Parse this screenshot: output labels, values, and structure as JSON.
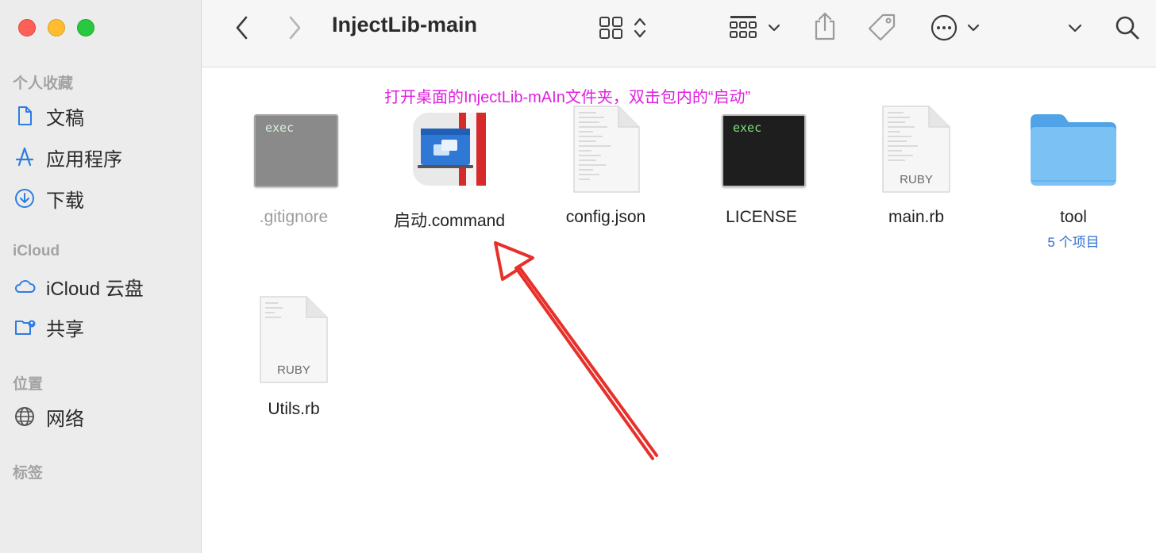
{
  "window": {
    "title": "InjectLib-main"
  },
  "sidebar": {
    "sections": [
      {
        "title": "个人收藏",
        "items": [
          {
            "label": "文稿",
            "icon": "document-icon"
          },
          {
            "label": "应用程序",
            "icon": "applications-icon"
          },
          {
            "label": "下载",
            "icon": "download-icon"
          }
        ]
      },
      {
        "title": "iCloud",
        "items": [
          {
            "label": "iCloud 云盘",
            "icon": "cloud-icon"
          },
          {
            "label": "共享",
            "icon": "shared-folder-icon"
          }
        ]
      },
      {
        "title": "位置",
        "items": [
          {
            "label": "网络",
            "icon": "network-icon"
          }
        ]
      },
      {
        "title": "标签",
        "items": []
      }
    ]
  },
  "toolbar": {
    "icons": [
      "back-icon",
      "forward-icon",
      "view-grid-icon",
      "group-icon",
      "share-icon",
      "tag-icon",
      "more-icon",
      "expand-icon",
      "search-icon"
    ]
  },
  "annotation": {
    "text": "打开桌面的InjectLib-mAIn文件夹，双击包内的“启动”",
    "color": "#e020e0",
    "arrow_color": "#e8302a"
  },
  "files": [
    {
      "name": ".gitignore",
      "kind": "exec",
      "icon_text": "exec",
      "dimmed": true
    },
    {
      "name": "启动.command",
      "kind": "app"
    },
    {
      "name": "config.json",
      "kind": "document"
    },
    {
      "name": "LICENSE",
      "kind": "exec",
      "icon_text": "exec"
    },
    {
      "name": "main.rb",
      "kind": "ruby",
      "icon_text": "RUBY"
    },
    {
      "name": "tool",
      "kind": "folder",
      "subtitle": "5 个项目"
    },
    {
      "name": "Utils.rb",
      "kind": "ruby",
      "icon_text": "RUBY"
    }
  ]
}
